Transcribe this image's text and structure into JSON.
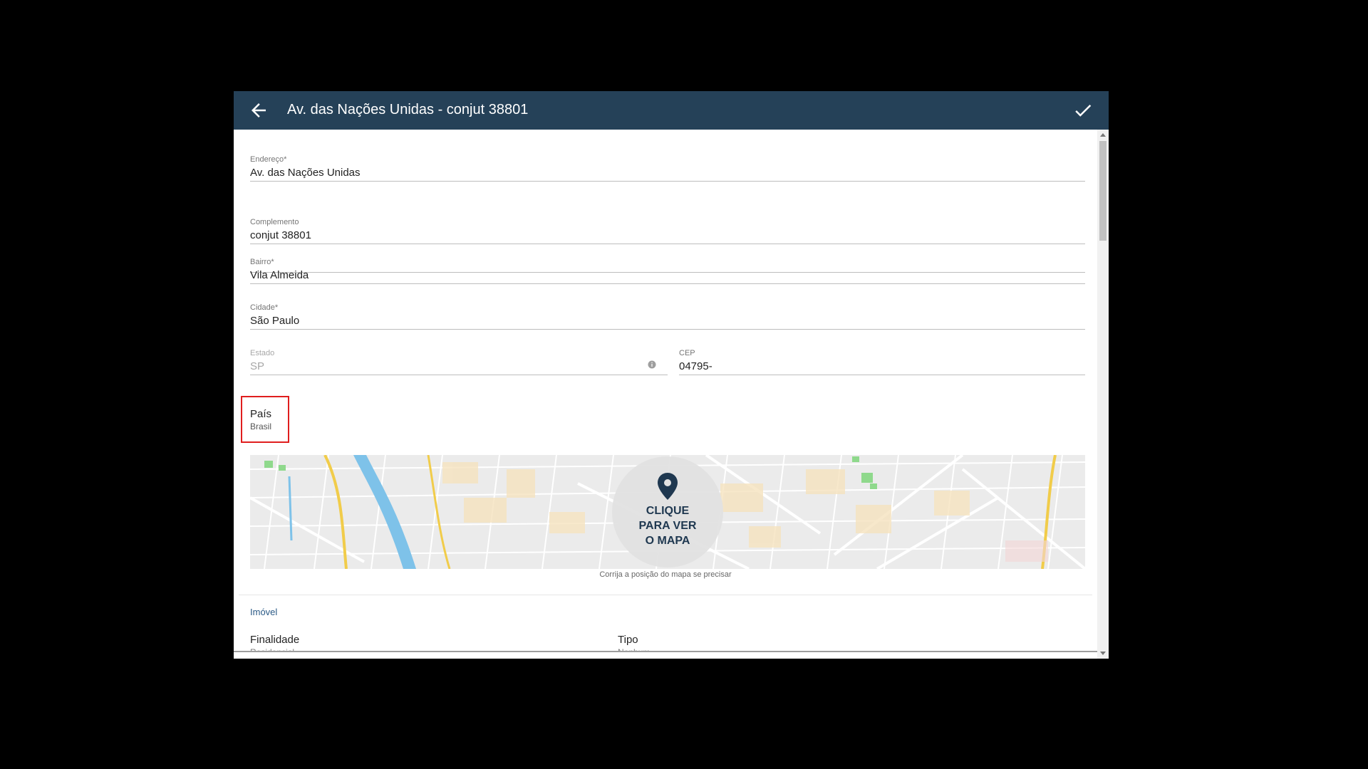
{
  "header": {
    "title": "Av. das Nações Unidas - conjut 38801",
    "back_icon": "arrow-left-icon",
    "confirm_icon": "check-icon"
  },
  "form": {
    "endereco": {
      "label": "Endereço*",
      "value": "Av. das Nações Unidas"
    },
    "complemento": {
      "label": "Complemento",
      "value": "conjut 38801"
    },
    "bairro": {
      "label": "Bairro*",
      "value": "Vila Almeida"
    },
    "cidade": {
      "label": "Cidade*",
      "value": "São Paulo"
    },
    "estado": {
      "label": "Estado",
      "value": "SP"
    },
    "cep": {
      "label": "CEP",
      "value": "04795-"
    },
    "pais": {
      "label": "País",
      "value": "Brasil"
    }
  },
  "map": {
    "cta": [
      "CLIQUE",
      "PARA VER",
      "O MAPA"
    ],
    "caption": "Corrija a posição do mapa se precisar"
  },
  "imovel": {
    "section_title": "Imóvel",
    "finalidade": {
      "label": "Finalidade",
      "value": "Residencial"
    },
    "tipo": {
      "label": "Tipo",
      "value": "Nenhum"
    }
  },
  "colors": {
    "appbar": "#254158",
    "accent_red": "#e01e1e",
    "section_title": "#2b5a86"
  }
}
